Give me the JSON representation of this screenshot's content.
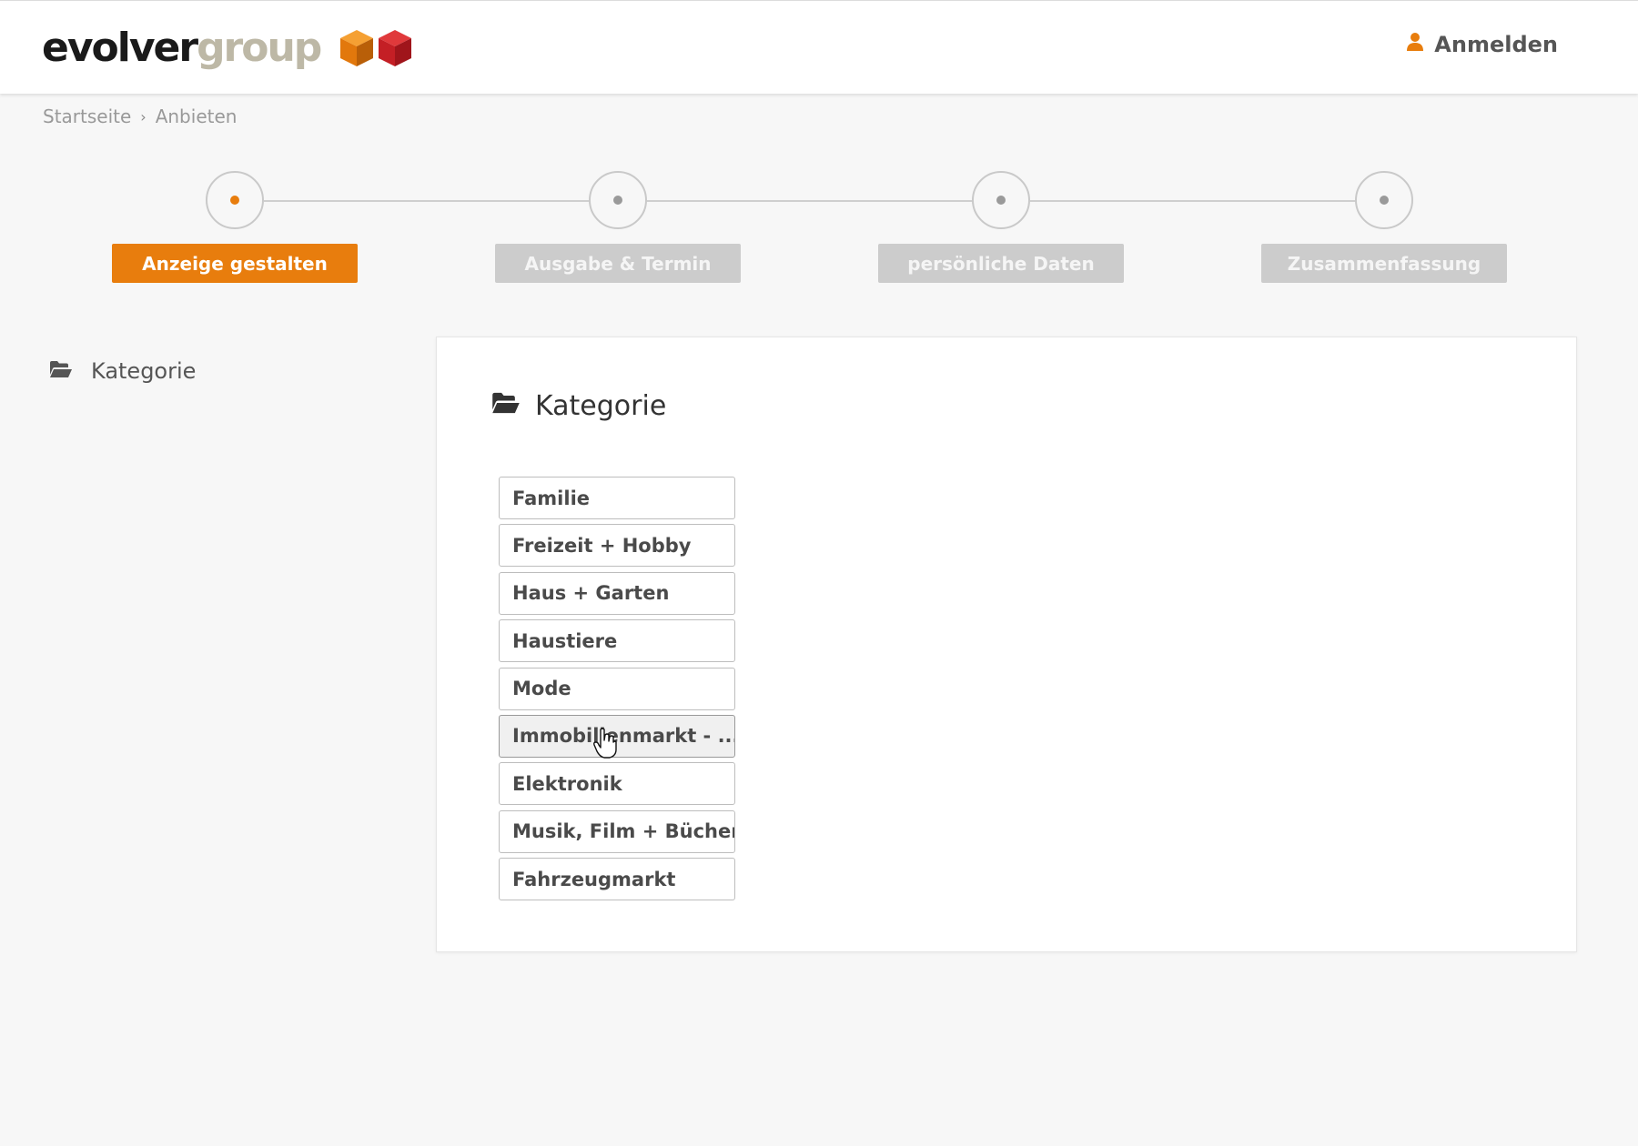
{
  "header": {
    "logo": {
      "part1": "evolver",
      "part2": "group"
    },
    "login_label": "Anmelden",
    "colors": {
      "brand_orange": "#e87d0d",
      "brand_red": "#c8102e",
      "logo_gray": "#bdb8a6"
    }
  },
  "breadcrumb": {
    "items": [
      "Startseite",
      "Anbieten"
    ],
    "separator": "›"
  },
  "steps": [
    {
      "label": "Anzeige gestalten",
      "active": true
    },
    {
      "label": "Ausgabe & Termin",
      "active": false
    },
    {
      "label": "persönliche Daten",
      "active": false
    },
    {
      "label": "Zusammenfassung",
      "active": false
    }
  ],
  "sidenav": {
    "label": "Kategorie",
    "icon": "folder-open-icon"
  },
  "card": {
    "title": "Kategorie",
    "icon": "folder-open-icon",
    "categories": [
      "Familie",
      "Freizeit + Hobby",
      "Haus + Garten",
      "Haustiere",
      "Mode",
      "Immobilienmarkt - ...",
      "Elektronik",
      "Musik, Film + Bücher",
      "Fahrzeugmarkt"
    ],
    "hovered_index": 5
  }
}
